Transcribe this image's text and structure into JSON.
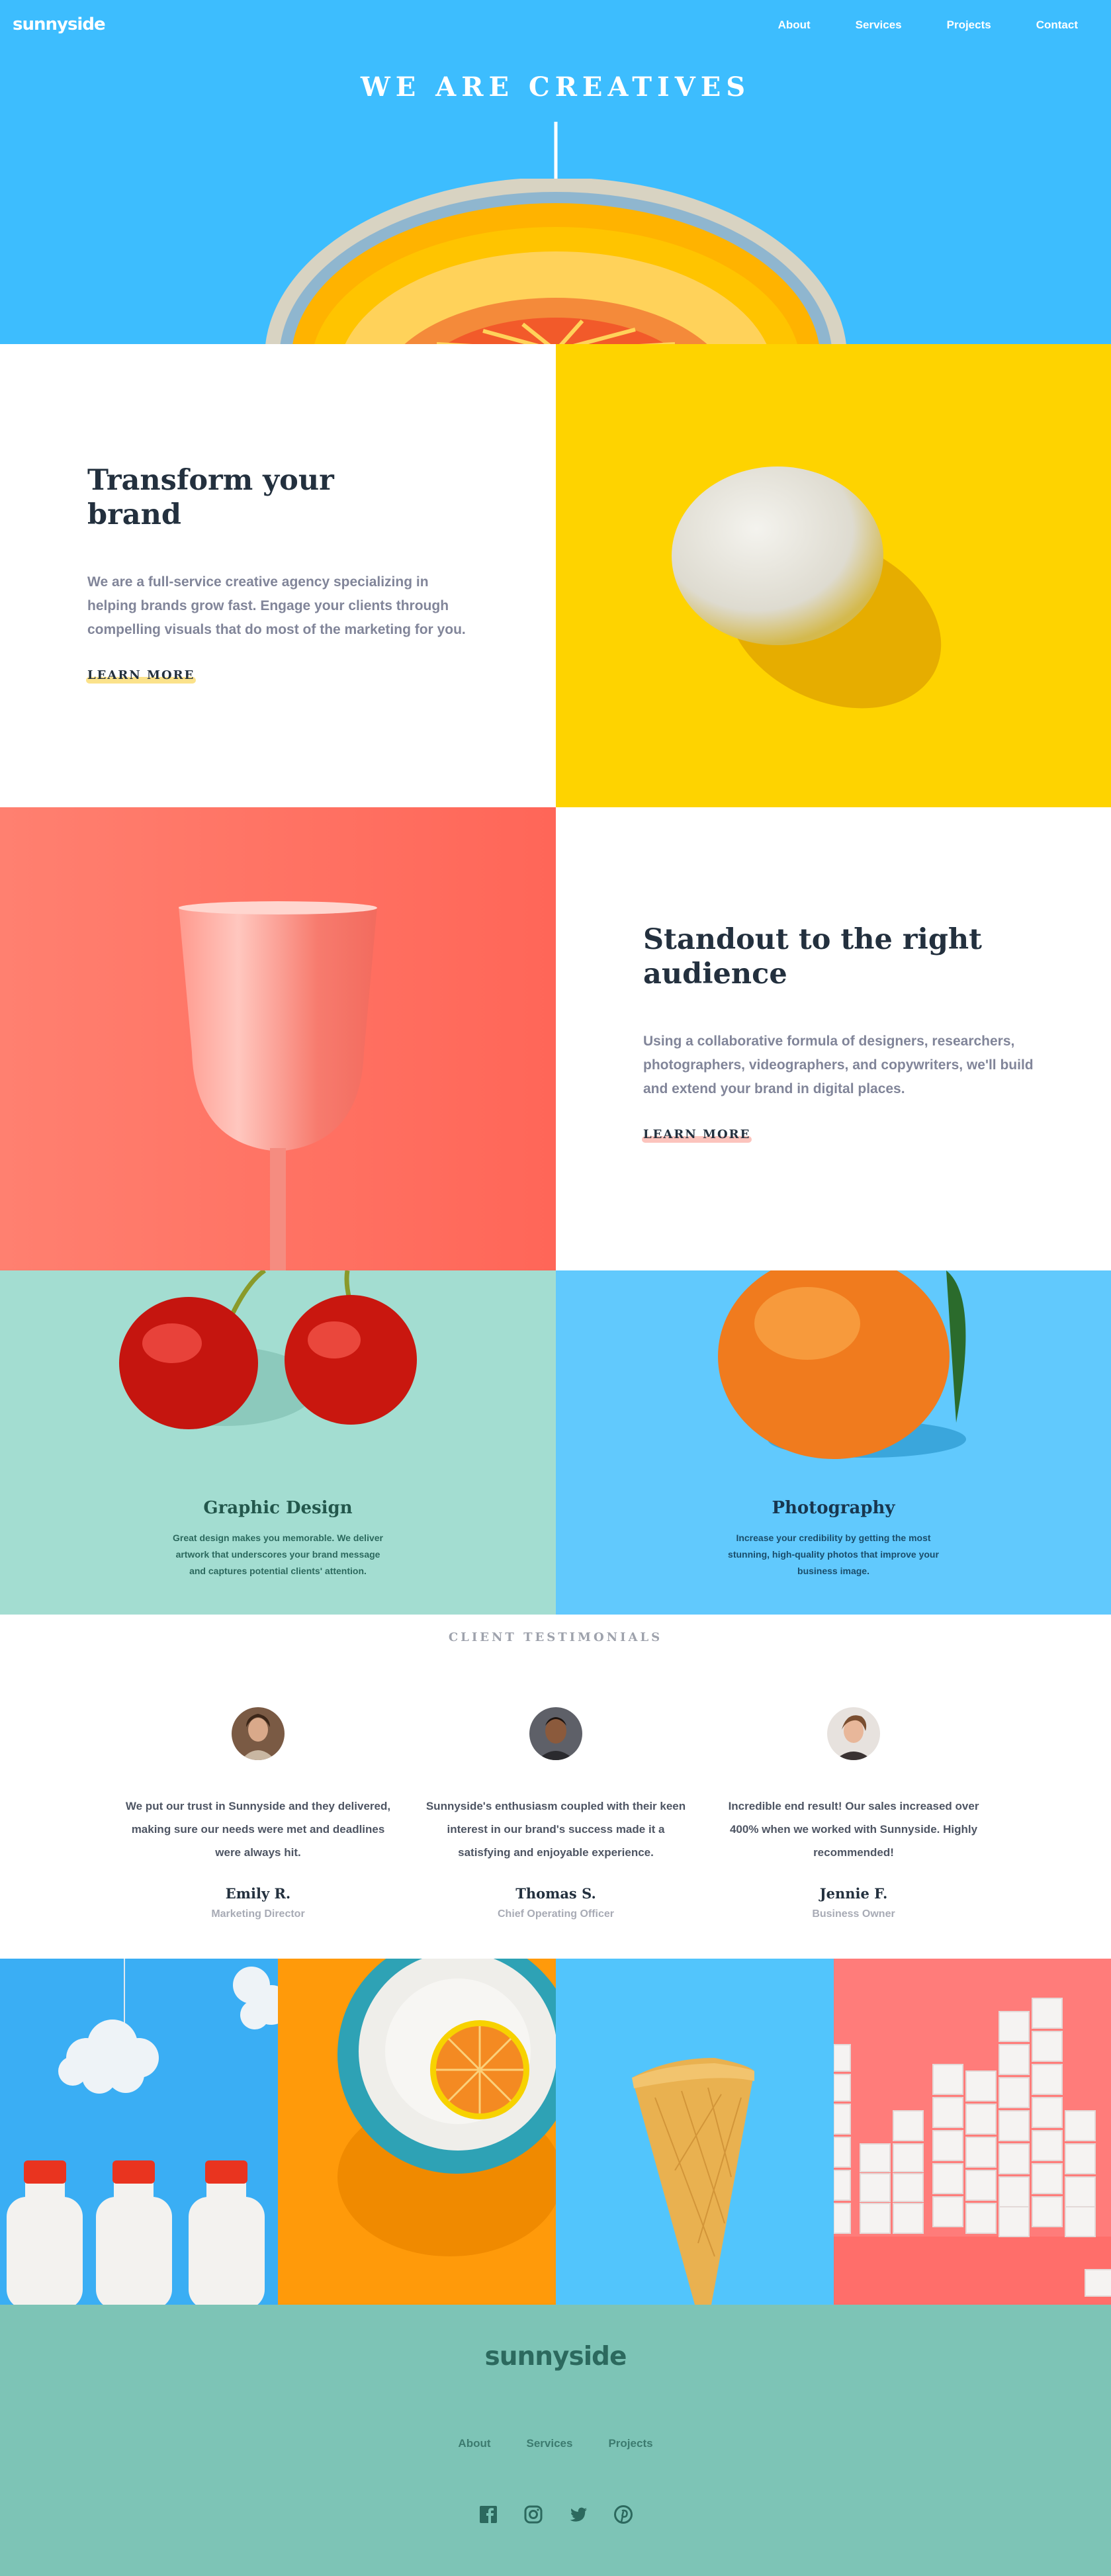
{
  "header": {
    "logo": "sunnyside",
    "nav": [
      "About",
      "Services",
      "Projects",
      "Contact"
    ]
  },
  "hero": {
    "title": "WE ARE CREATIVES"
  },
  "features": [
    {
      "title_line1": "Transform your",
      "title_line2": "brand",
      "body": "We are a full-service creative agency specializing in helping brands grow fast. Engage your clients through compelling visuals that do most of the marketing for you.",
      "link": "LEARN MORE",
      "accent": "#fad400"
    },
    {
      "title_line1": "Standout to the right",
      "title_line2": "audience",
      "body": "Using a collaborative formula of designers, researchers, photographers, videographers, and copywriters, we'll build and extend your brand in digital places.",
      "link": "LEARN MORE",
      "accent": "#ff8b7d"
    }
  ],
  "services": [
    {
      "title": "Graphic Design",
      "body": "Great design makes you memorable. We deliver artwork that underscores your brand message and captures potential clients' attention."
    },
    {
      "title": "Photography",
      "body": "Increase your credibility by getting the most stunning, high-quality photos that improve your business image."
    }
  ],
  "testimonials": {
    "heading": "CLIENT TESTIMONIALS",
    "items": [
      {
        "quote": "We put our trust in Sunnyside and they delivered, making sure our needs were met and deadlines were always hit.",
        "name": "Emily R.",
        "role": "Marketing Director"
      },
      {
        "quote": "Sunnyside's enthusiasm coupled with their keen interest in our brand's success made it a satisfying and enjoyable experience.",
        "name": "Thomas S.",
        "role": "Chief Operating Officer"
      },
      {
        "quote": "Incredible end result! Our sales increased over 400% when we worked with Sunnyside. Highly recommended!",
        "name": "Jennie F.",
        "role": "Business Owner"
      }
    ]
  },
  "footer": {
    "logo": "sunnyside",
    "nav": [
      "About",
      "Services",
      "Projects"
    ],
    "social_icons": [
      "facebook-icon",
      "instagram-icon",
      "twitter-icon",
      "pinterest-icon"
    ]
  },
  "colors": {
    "hero_bg": "#3dbdfe",
    "yellow": "#fed000",
    "coral": "#ff6f61",
    "mint": "#9fe0d3",
    "sky": "#5ecbff",
    "footer_bg": "#7dc4b6",
    "dark": "#23303e"
  }
}
